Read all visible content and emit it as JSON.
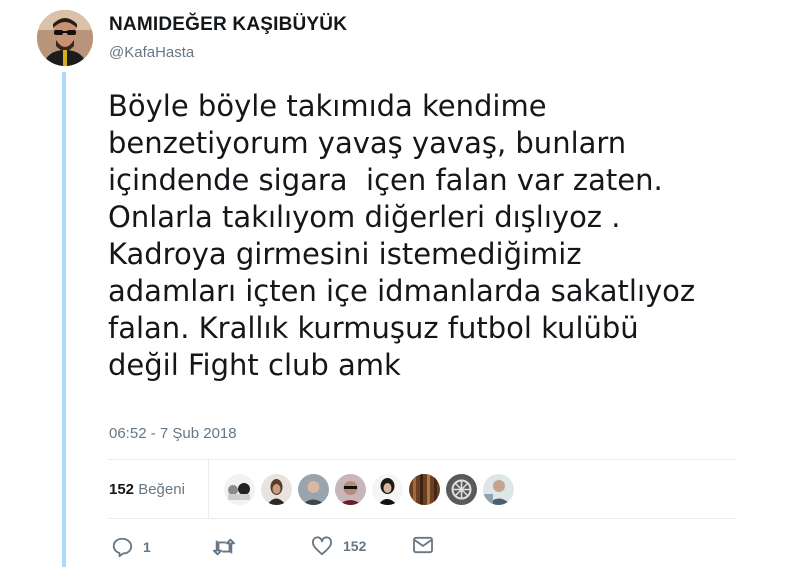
{
  "tweet": {
    "author_name": "NAMIDEĞER KAŞIBÜYÜK",
    "author_handle": "@KafaHasta",
    "text_lines": [
      "Böyle böyle takımıda kendime",
      "benzetiyorum yavaş yavaş, bunlarn",
      "içindende sigara  içen falan var zaten.",
      "Onlarla takılıyom diğerleri dışlıyoz .",
      "Kadroya girmesini istemediğimiz",
      "adamları içten içe idmanlarda sakatlıyoz",
      "falan. Krallık kurmuşuz futbol kulübü",
      "değil Fight club amk"
    ],
    "timestamp": "06:52 - 7 Şub 2018"
  },
  "stats": {
    "likes_count": "152",
    "likes_label": "Beğeni",
    "liker_avatars": [
      "avatar-1",
      "avatar-2",
      "avatar-3",
      "avatar-4",
      "avatar-5",
      "avatar-6",
      "avatar-7",
      "avatar-8"
    ]
  },
  "actions": {
    "reply_icon": "reply-icon",
    "reply_count": "1",
    "retweet_icon": "retweet-icon",
    "like_icon": "heart-icon",
    "like_count": "152",
    "dm_icon": "envelope-icon"
  },
  "colors": {
    "thread_line": "#aed8f5",
    "secondary_text": "#657786",
    "divider": "#e6ecf0"
  }
}
